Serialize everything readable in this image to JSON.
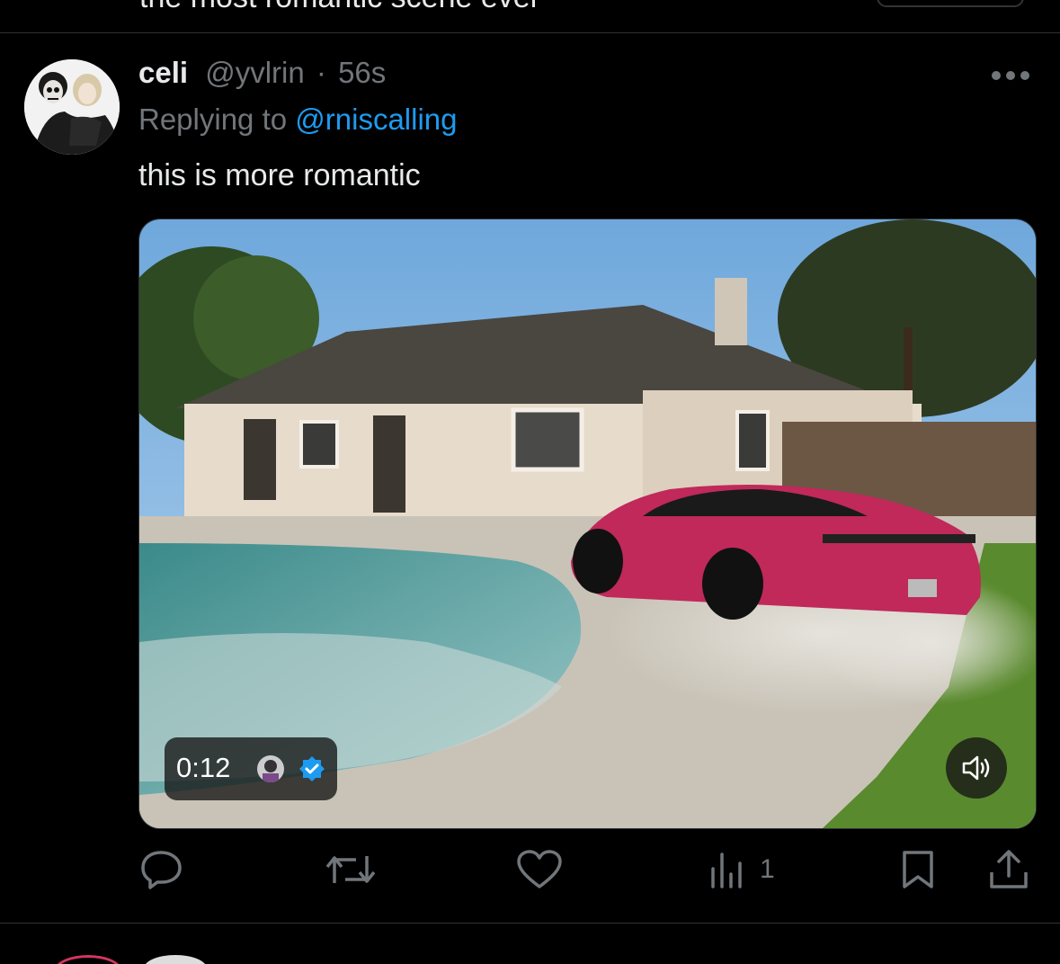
{
  "previous_tweet": {
    "text": "the most romantic scene ever"
  },
  "tweet": {
    "display_name": "celi",
    "handle": "@yvlrin",
    "separator": "·",
    "timestamp": "56s",
    "reply_prefix": "Replying to",
    "reply_to": "@rniscalling",
    "text": "this is more romantic",
    "media": {
      "type": "video",
      "duration": "0:12",
      "sound_state": "muted"
    },
    "actions": {
      "reply_count": "",
      "repost_count": "",
      "like_count": "",
      "views_count": "1"
    }
  },
  "colors": {
    "background": "#000000",
    "primary_text": "#e7e9ea",
    "secondary_text": "#71767b",
    "accent": "#1d9bf0",
    "divider": "#2f3336"
  },
  "icons": [
    "more-icon",
    "reply-icon",
    "repost-icon",
    "like-icon",
    "views-icon",
    "bookmark-icon",
    "share-icon",
    "verified-icon",
    "speaker-icon"
  ]
}
